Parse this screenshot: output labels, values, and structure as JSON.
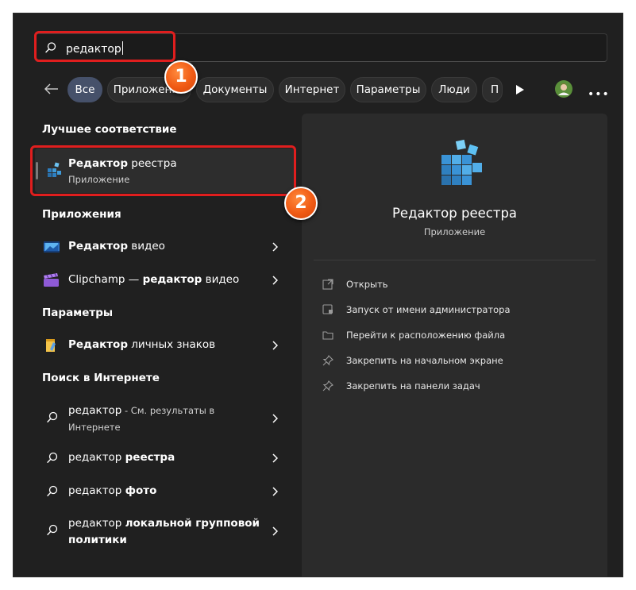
{
  "search": {
    "query": "редактор"
  },
  "filters": {
    "chips": [
      {
        "label": "Все",
        "active": true
      },
      {
        "label": "Приложения"
      },
      {
        "label": "Документы"
      },
      {
        "label": "Интернет"
      },
      {
        "label": "Параметры"
      },
      {
        "label": "Люди"
      },
      {
        "label": "П"
      }
    ]
  },
  "best_match": {
    "heading": "Лучшее соответствие",
    "title_bold": "Редактор",
    "title_rest": " реестра",
    "subtitle": "Приложение"
  },
  "apps": {
    "heading": "Приложения",
    "items": [
      {
        "bold": "Редактор",
        "rest": " видео",
        "icon": "video-editor-icon"
      },
      {
        "pre": "Clipchamp — ",
        "bold": "редактор",
        "rest": " видео",
        "icon": "clipchamp-icon"
      }
    ]
  },
  "settings": {
    "heading": "Параметры",
    "items": [
      {
        "bold": "Редактор",
        "rest": " личных знаков",
        "icon": "character-editor-icon"
      }
    ]
  },
  "web": {
    "heading": "Поиск в Интернете",
    "items": [
      {
        "pre": "редактор",
        "small": " - См. результаты в",
        "line2": "Интернете"
      },
      {
        "pre": "редактор ",
        "bold": "реестра"
      },
      {
        "pre": "редактор ",
        "bold": "фото"
      },
      {
        "pre": "редактор ",
        "bold": "локальной групповой",
        "line2_bold": "политики"
      }
    ]
  },
  "details": {
    "title": "Редактор реестра",
    "subtitle": "Приложение",
    "actions": [
      {
        "label": "Открыть",
        "icon": "open-icon"
      },
      {
        "label": "Запуск от имени администратора",
        "icon": "admin-shield-icon"
      },
      {
        "label": "Перейти к расположению файла",
        "icon": "folder-icon"
      },
      {
        "label": "Закрепить на начальном экране",
        "icon": "pin-icon"
      },
      {
        "label": "Закрепить на панели задач",
        "icon": "pin-icon"
      }
    ]
  },
  "annotations": {
    "badge1": "1",
    "badge2": "2"
  },
  "colors": {
    "window_bg": "#202020",
    "panel_bg": "#2b2b2b",
    "chip_active": "#46516a",
    "callout": "#e01e1e",
    "badge": "#f05a14"
  }
}
